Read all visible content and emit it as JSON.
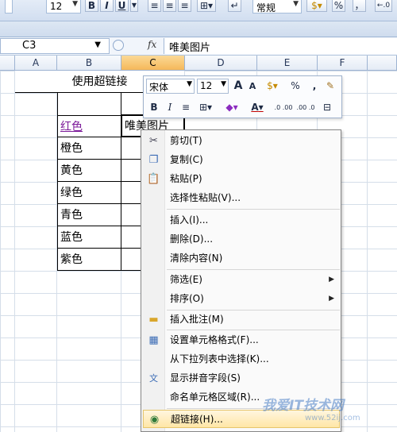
{
  "ribbon": {
    "font_size": "12",
    "bold": "B",
    "italic": "I",
    "underline": "U",
    "number_format": "常规",
    "percent": "%",
    "comma": "，"
  },
  "formula_bar": {
    "name_box": "C3",
    "fx_label": "fx",
    "formula_value": "唯美图片"
  },
  "columns": [
    "A",
    "B",
    "C",
    "D",
    "E",
    "F"
  ],
  "cells": {
    "header_text": "使用超链接",
    "b3": "红色",
    "c3": "唯美图片",
    "b_colors": [
      "橙色",
      "黄色",
      "绿色",
      "青色",
      "蓝色",
      "紫色"
    ]
  },
  "mini_toolbar": {
    "font_name": "宋体",
    "font_size": "12",
    "grow_font": "A",
    "shrink_font": "A",
    "percent": "%",
    "comma": ",",
    "bold": "B",
    "italic": "I",
    "font_color": "A",
    "inc_decimal": ".0 .00",
    "dec_decimal": ".00 .0"
  },
  "context_menu": {
    "items": [
      {
        "label": "剪切(T)",
        "icon": "scissors-icon"
      },
      {
        "label": "复制(C)",
        "icon": "copy-icon"
      },
      {
        "label": "粘贴(P)",
        "icon": "paste-icon"
      },
      {
        "label": "选择性粘贴(V)..."
      },
      {
        "label": "插入(I)..."
      },
      {
        "label": "删除(D)..."
      },
      {
        "label": "清除内容(N)"
      },
      {
        "label": "筛选(E)",
        "submenu": true
      },
      {
        "label": "排序(O)",
        "submenu": true
      },
      {
        "label": "插入批注(M)",
        "icon": "folder-icon"
      },
      {
        "label": "设置单元格格式(F)...",
        "icon": "format-cells-icon"
      },
      {
        "label": "从下拉列表中选择(K)..."
      },
      {
        "label": "显示拼音字段(S)",
        "icon": "phonetic-icon"
      },
      {
        "label": "命名单元格区域(R)..."
      },
      {
        "label": "超链接(H)...",
        "icon": "hyperlink-globe-icon",
        "highlighted": true
      }
    ]
  },
  "watermark": {
    "text": "我爱IT技术网",
    "url": "www.52ij.com"
  },
  "colors": {
    "link": "#7c1a99",
    "selected_column": "#f5b85a",
    "menu_highlight": "#ffe6a6"
  }
}
